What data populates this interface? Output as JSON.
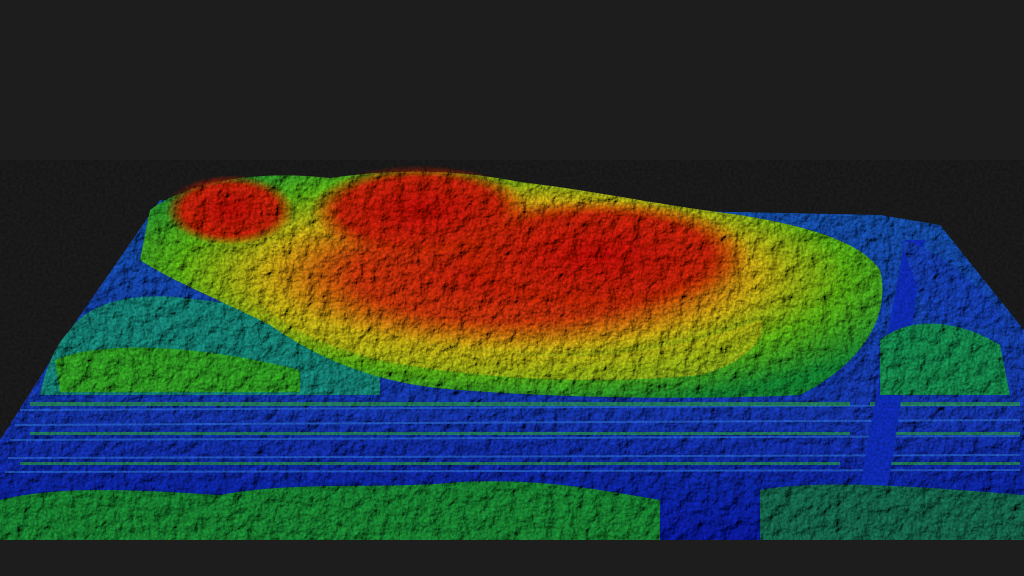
{
  "scene": {
    "subject": "",
    "background_color": "#1d1d1d",
    "colormap": [
      "#0a1fb8",
      "#1a4fd6",
      "#1aa0a0",
      "#22c02a",
      "#9ad61a",
      "#f0d21a",
      "#f08a14",
      "#e01a0a"
    ],
    "low_color": "#0a1fb8",
    "mid_color": "#22c02a",
    "high_color": "#e01a0a"
  }
}
